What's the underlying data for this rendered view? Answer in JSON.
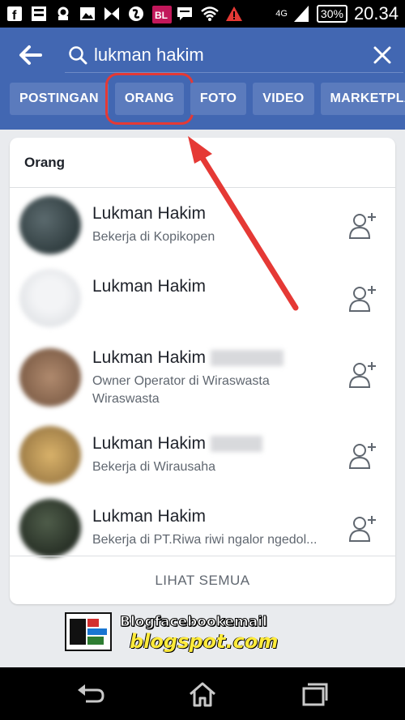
{
  "status_bar": {
    "network": "4G",
    "battery": "30%",
    "time": "20.34"
  },
  "search": {
    "query": "lukman hakim",
    "placeholder": ""
  },
  "tabs": [
    {
      "label": "POSTINGAN"
    },
    {
      "label": "ORANG"
    },
    {
      "label": "FOTO"
    },
    {
      "label": "VIDEO"
    },
    {
      "label": "MARKETPLA"
    }
  ],
  "people_section": {
    "title": "Orang",
    "results": [
      {
        "name": "Lukman Hakim",
        "line1": "Bekerja di Kopikopen",
        "line2": ""
      },
      {
        "name": "Lukman Hakim",
        "line1": "",
        "line2": ""
      },
      {
        "name": "Lukman Hakim",
        "line1": "Owner Operator di Wiraswasta",
        "line2": "Wiraswasta"
      },
      {
        "name": "Lukman Hakim",
        "line1": "Bekerja di Wirausaha",
        "line2": ""
      },
      {
        "name": "Lukman Hakim",
        "line1": "Bekerja di PT.Riwa riwi ngalor ngedol...",
        "line2": ""
      }
    ],
    "see_all": "LIHAT SEMUA"
  },
  "watermark": {
    "line1": "Blogfacebookemail",
    "line2": "blogspot.com"
  },
  "colors": {
    "brand": "#4267b2",
    "tab_bg": "#5b7bbd",
    "highlight": "#e53935"
  }
}
